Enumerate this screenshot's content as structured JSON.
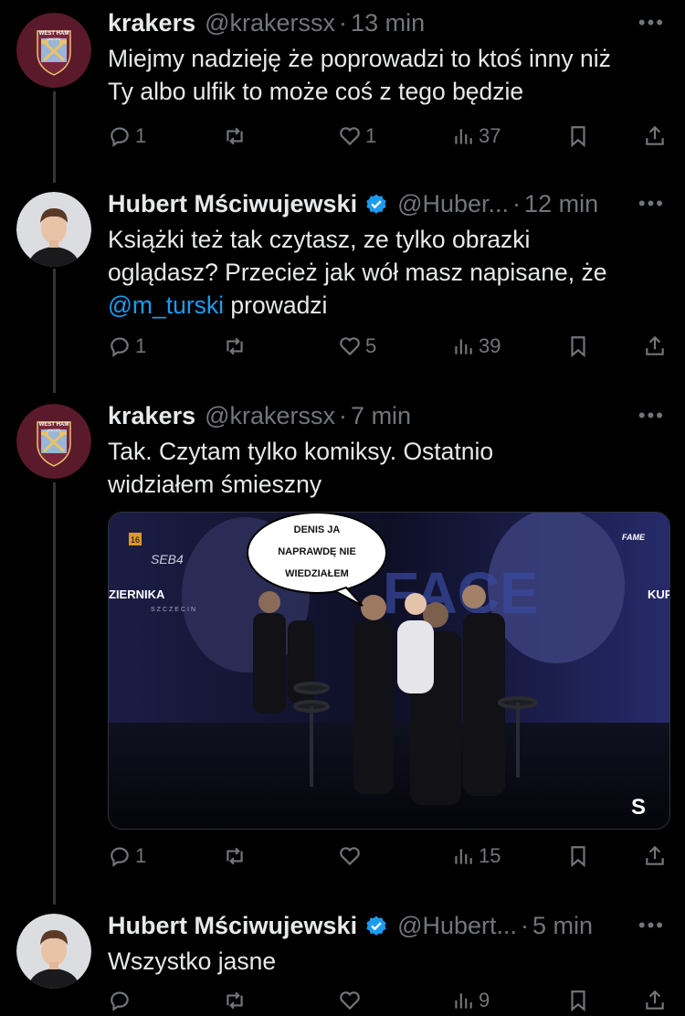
{
  "tweets": [
    {
      "name": "krakers",
      "handle": "@krakerssx",
      "time": "13 min",
      "text_lines": [
        "Miejmy nadzieję że poprowadzi to ktoś inny niż",
        "Ty albo ulfik to może coś z tego będzie"
      ],
      "replies": "1",
      "retweets": "",
      "likes": "1",
      "views": "37"
    },
    {
      "name": "Hubert Mściwujewski",
      "handle": "@Huber...",
      "time": "12 min",
      "text_lines": [
        "Książki też tak czytasz, ze tylko obrazki",
        "oglądasz? Przecież jak wół masz napisane, że"
      ],
      "mention": "@m_turski",
      "after_mention": " prowadzi",
      "replies": "1",
      "retweets": "",
      "likes": "5",
      "views": "39"
    },
    {
      "name": "krakers",
      "handle": "@krakerssx",
      "time": "7 min",
      "text_lines": [
        "Tak. Czytam tylko komiksy. Ostatnio",
        "widziałem śmieszny"
      ],
      "replies": "1",
      "retweets": "",
      "likes": "",
      "views": "15",
      "media": {
        "bubble_lines": [
          "DENIS JA",
          "NAPRAWDĘ NIE",
          "WIEDZIAŁEM"
        ],
        "left_label": "SEB4",
        "left_badge": "16",
        "left_name": "ZIERNIKA",
        "left_city": "SZCZECIN",
        "right_brand": "FAME",
        "right_name": "KUP",
        "watermark": "S"
      }
    },
    {
      "name": "Hubert Mściwujewski",
      "handle": "@Hubert...",
      "time": "5 min",
      "text_lines": [
        "Wszystko jasne"
      ],
      "replies": "",
      "retweets": "",
      "likes": "",
      "views": "9"
    }
  ],
  "colors": {
    "background": "#000000",
    "text": "#e7e9ea",
    "muted": "#71767b",
    "link": "#1d9bf0",
    "verified": "#1d9bf0"
  },
  "icons": [
    "reply-icon",
    "retweet-icon",
    "like-icon",
    "views-icon",
    "bookmark-icon",
    "share-icon",
    "more-icon",
    "verified-badge-icon"
  ]
}
